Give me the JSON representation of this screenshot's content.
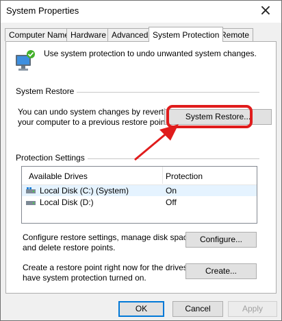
{
  "window": {
    "title": "System Properties"
  },
  "tabs": [
    {
      "label": "Computer Name"
    },
    {
      "label": "Hardware"
    },
    {
      "label": "Advanced"
    },
    {
      "label": "System Protection"
    },
    {
      "label": "Remote"
    }
  ],
  "intro_text": "Use system protection to undo unwanted system changes.",
  "system_restore": {
    "heading": "System Restore",
    "desc_line1": "You can undo system changes by reverting",
    "desc_line2": "your computer to a previous restore point.",
    "button": "System Restore..."
  },
  "protection": {
    "heading": "Protection Settings",
    "col_drives": "Available Drives",
    "col_protection": "Protection",
    "drives": [
      {
        "name": "Local Disk (C:) (System)",
        "protection": "On"
      },
      {
        "name": "Local Disk (D:)",
        "protection": "Off"
      }
    ]
  },
  "configure": {
    "line1": "Configure restore settings, manage disk space,",
    "line2": "and delete restore points.",
    "button": "Configure..."
  },
  "create": {
    "line1": "Create a restore point right now for the drives that",
    "line2": "have system protection turned on.",
    "button": "Create..."
  },
  "footer": {
    "ok": "OK",
    "cancel": "Cancel",
    "apply": "Apply"
  },
  "colors": {
    "annotation": "#e01c1c",
    "focus": "#0078d7"
  }
}
